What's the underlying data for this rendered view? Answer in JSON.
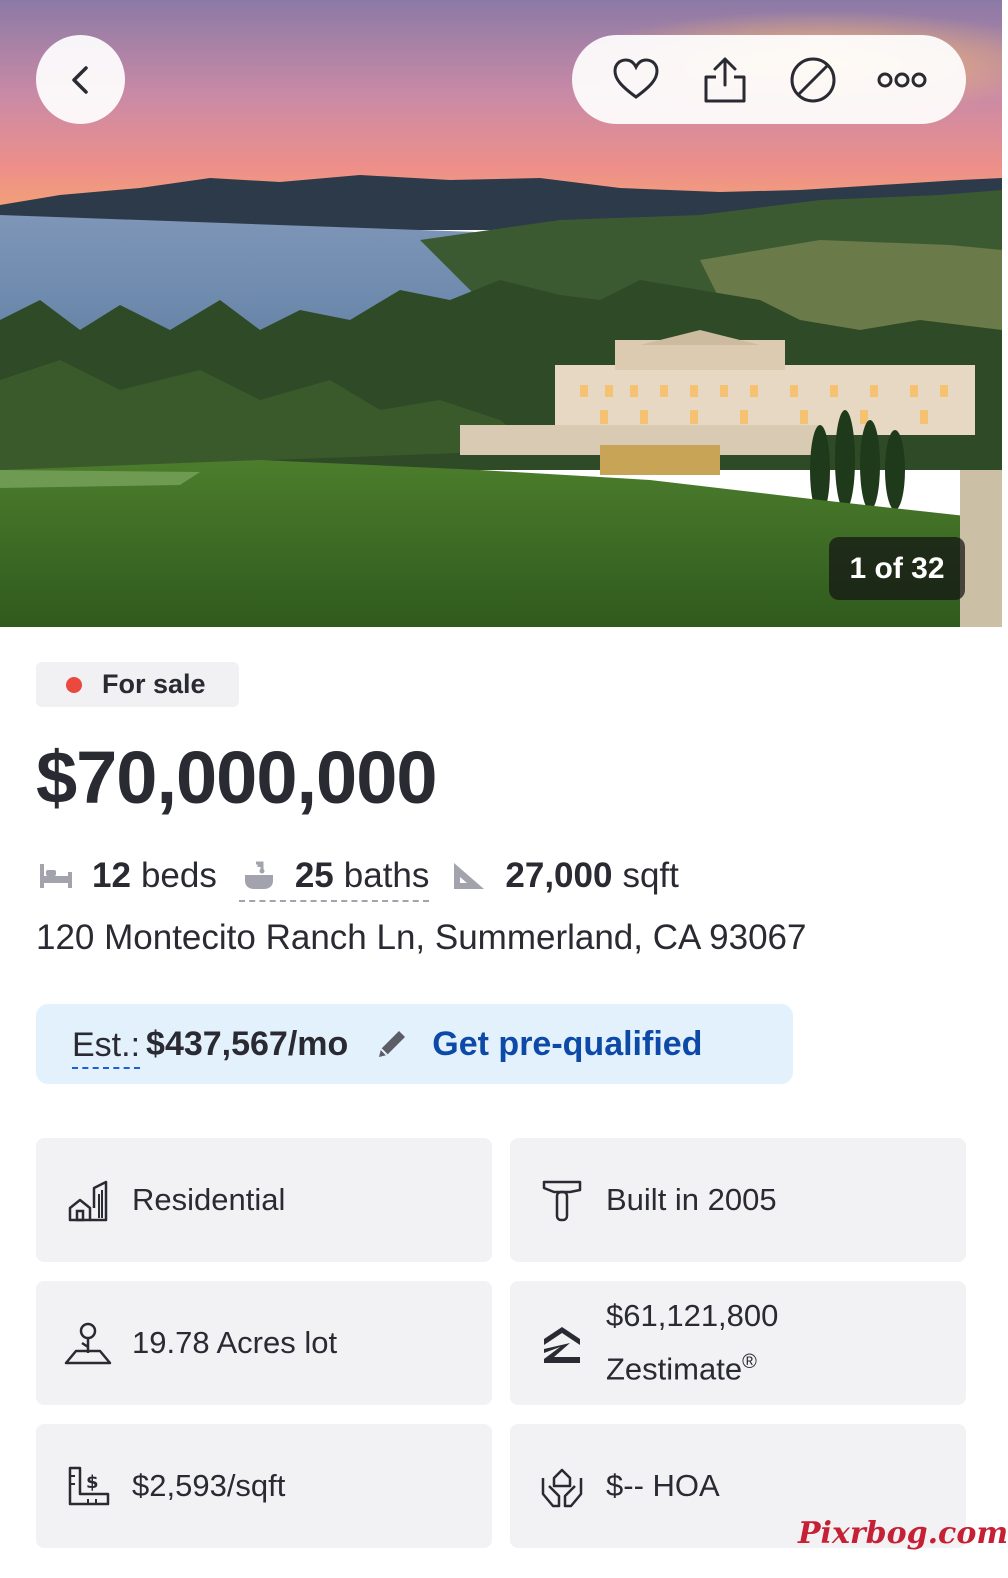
{
  "hero": {
    "photo_counter": "1 of 32",
    "back_icon": "chevron-left-icon",
    "actions": [
      "heart-icon",
      "share-icon",
      "hide-icon",
      "more-icon"
    ]
  },
  "listing": {
    "status": "For sale",
    "status_color": "#ea4a3d",
    "price": "$70,000,000",
    "beds_num": "12",
    "beds_label": "beds",
    "baths_num": "25",
    "baths_label": "baths",
    "sqft_num": "27,000",
    "sqft_label": "sqft",
    "address": "120 Montecito Ranch Ln, Summerland, CA 93067"
  },
  "estimate": {
    "label": "Est.:",
    "amount": "$437,567/mo",
    "cta": "Get pre-qualified",
    "accent": "#0d4aa8"
  },
  "facts": {
    "type": "Residential",
    "built": "Built in 2005",
    "lot": "19.78 Acres lot",
    "zestimate_value": "$61,121,800",
    "zestimate_label": "Zestimate",
    "zestimate_mark": "®",
    "price_per_sqft": "$2,593/sqft",
    "hoa": "$-- HOA"
  },
  "watermark": "Pixrbog.com"
}
